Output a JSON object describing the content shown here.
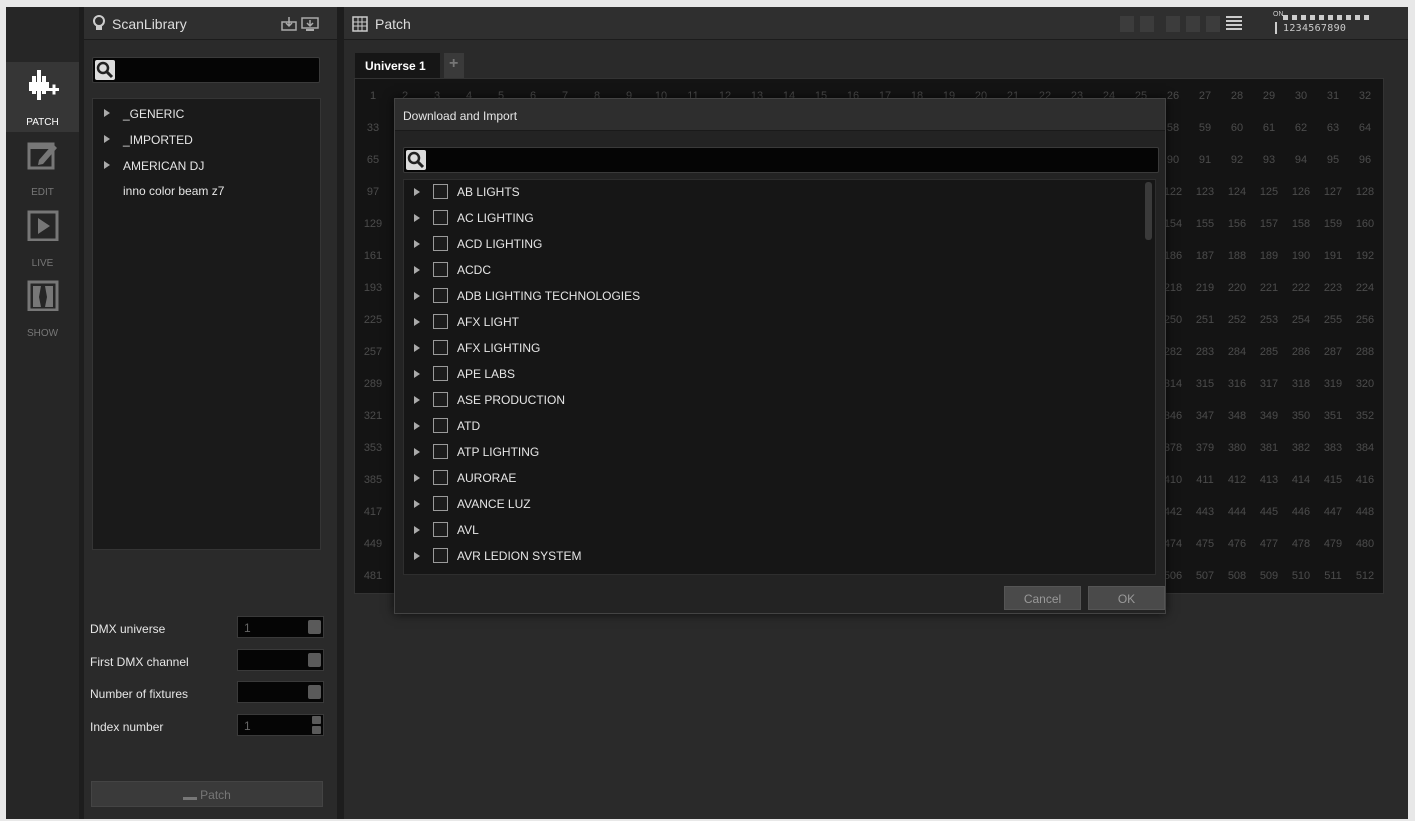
{
  "modebar": {
    "items": [
      {
        "label": "PATCH",
        "icon": "patch-plug-icon",
        "active": true
      },
      {
        "label": "EDIT",
        "icon": "edit-icon",
        "active": false
      },
      {
        "label": "LIVE",
        "icon": "play-icon",
        "active": false
      },
      {
        "label": "SHOW",
        "icon": "show-curtain-icon",
        "active": false
      }
    ]
  },
  "library": {
    "title": "ScanLibrary",
    "search_value": "",
    "tree": [
      {
        "label": "_GENERIC",
        "expandable": true
      },
      {
        "label": "_IMPORTED",
        "expandable": true
      },
      {
        "label": "AMERICAN DJ",
        "expandable": true
      },
      {
        "label": "inno color beam z7",
        "expandable": false
      }
    ],
    "form": {
      "dmx_universe_label": "DMX universe",
      "dmx_universe_value": "1",
      "first_channel_label": "First DMX channel",
      "first_channel_value": "",
      "num_fixtures_label": "Number of fixtures",
      "num_fixtures_value": "",
      "index_label": "Index number",
      "index_value": "1"
    },
    "patch_button": "Patch"
  },
  "patch": {
    "title": "Patch",
    "tabs": [
      {
        "label": "Universe 1",
        "active": true
      }
    ],
    "add_tab_label": "+",
    "toolbar_on_label": "ON",
    "toolbar_digits": "1234567890",
    "columns": 32,
    "rows": 16,
    "channel_start": 1,
    "channel_end": 512
  },
  "dialog": {
    "title": "Download and Import",
    "search_value": "",
    "manufacturers": [
      "AB LIGHTS",
      "AC LIGHTING",
      "ACD LIGHTING",
      "ACDC",
      "ADB LIGHTING TECHNOLOGIES",
      "AFX LIGHT",
      "AFX LIGHTING",
      "APE LABS",
      "ASE PRODUCTION",
      "ATD",
      "ATP LIGHTING",
      "AURORAE",
      "AVANCE LUZ",
      "AVL",
      "AVR LEDION SYSTEM"
    ],
    "cancel_label": "Cancel",
    "ok_label": "OK"
  },
  "colors": {
    "background": "#1d1d1d",
    "panel": "#2a2a2a",
    "text": "#e6e6e6",
    "muted": "#4c4c4c"
  }
}
